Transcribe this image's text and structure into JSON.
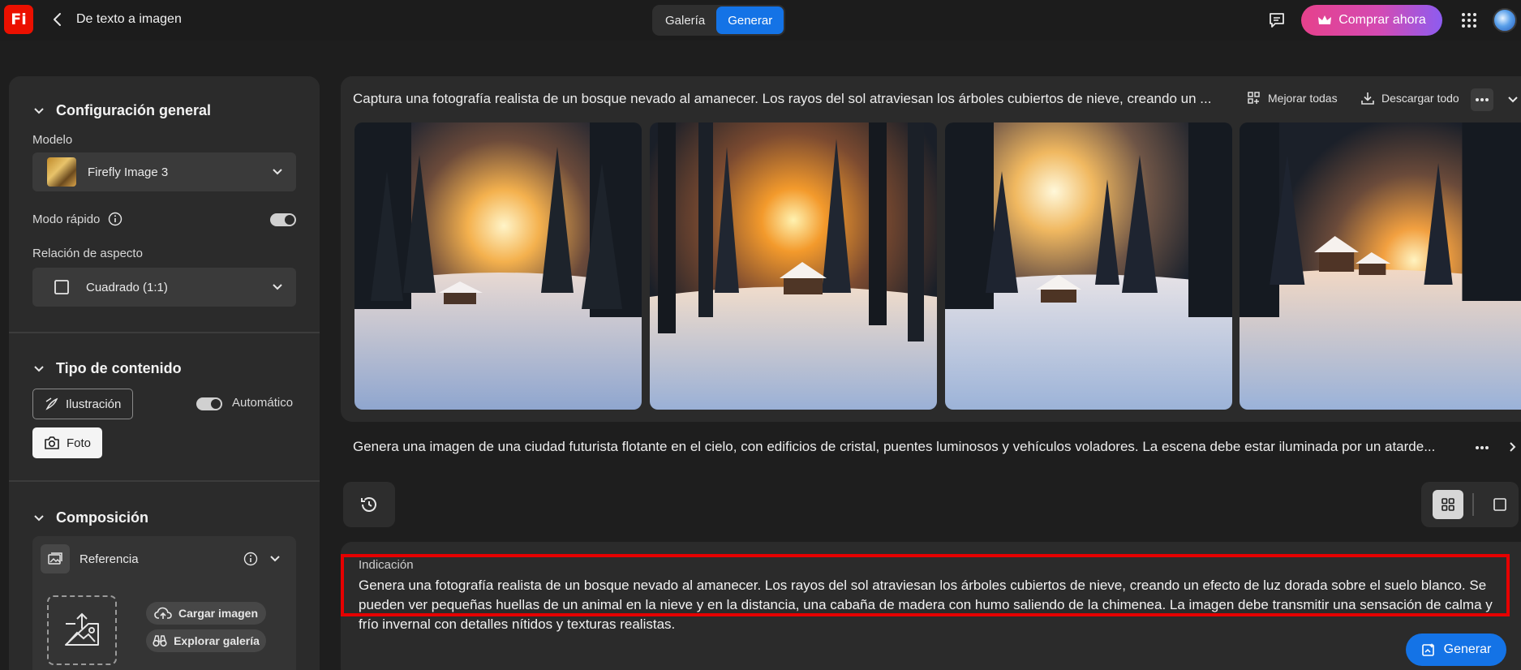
{
  "app": {
    "logo": "Fi",
    "title": "De texto a imagen"
  },
  "topnav": {
    "tabs": [
      {
        "label": "Galería",
        "active": false
      },
      {
        "label": "Generar",
        "active": true
      }
    ],
    "buy_label": "Comprar ahora",
    "accent": "#1473e6"
  },
  "sidebar": {
    "general": {
      "heading": "Configuración general",
      "model_label": "Modelo",
      "model_value": "Firefly Image 3",
      "fast_mode_label": "Modo rápido",
      "fast_mode_on": true,
      "aspect_label": "Relación de aspecto",
      "aspect_value": "Cuadrado (1:1)"
    },
    "content_type": {
      "heading": "Tipo de contenido",
      "illustration": "Ilustración",
      "photo": "Foto",
      "auto_label": "Automático",
      "auto_on": true
    },
    "composition": {
      "heading": "Composición",
      "reference_label": "Referencia",
      "upload_label": "Cargar imagen",
      "explore_label": "Explorar galería"
    }
  },
  "results": {
    "prompt_1": "Captura una fotografía realista de un bosque nevado al amanecer. Los rayos del sol atraviesan los árboles cubiertos de nieve, creando un ...",
    "improve_all": "Mejorar todas",
    "download_all": "Descargar todo",
    "prompt_2": "Genera una imagen de una ciudad futurista flotante en el cielo, con edificios de cristal, puentes luminosos y vehículos voladores. La escena debe estar iluminada por un atarde..."
  },
  "prompt_input": {
    "label": "Indicación",
    "text": "Genera una fotografía realista de un bosque nevado al amanecer. Los rayos del sol atraviesan los árboles cubiertos de nieve, creando un efecto de luz dorada sobre el suelo blanco. Se pueden ver pequeñas huellas de un animal en la nieve y en la distancia, una cabaña de madera con humo saliendo de la chimenea. La imagen debe transmitir una sensación de calma y frío invernal con detalles nítidos y texturas realistas.",
    "generate_label": "Generar",
    "highlight_color": "#e60000"
  }
}
